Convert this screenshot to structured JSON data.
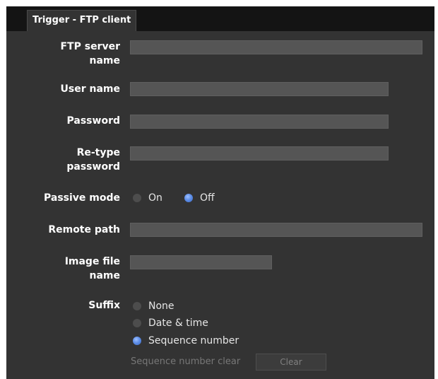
{
  "tab": {
    "title": "Trigger - FTP client"
  },
  "fields": {
    "ftp_server_name": {
      "label_line1": "FTP server",
      "label_line2": "name",
      "value": ""
    },
    "user_name": {
      "label": "User name",
      "value": ""
    },
    "password": {
      "label": "Password",
      "value": ""
    },
    "retype_password": {
      "label_line1": "Re-type",
      "label_line2": "password",
      "value": ""
    },
    "remote_path": {
      "label": "Remote path",
      "value": ""
    },
    "image_file_name": {
      "label_line1": "Image file",
      "label_line2": "name",
      "value": ""
    }
  },
  "passive_mode": {
    "label": "Passive mode",
    "options": [
      "On",
      "Off"
    ],
    "selected": "Off"
  },
  "suffix": {
    "label": "Suffix",
    "options": [
      "None",
      "Date & time",
      "Sequence number"
    ],
    "selected": "Sequence number"
  },
  "sequence_clear": {
    "label": "Sequence number clear",
    "button_label": "Clear"
  },
  "colors": {
    "panel_bg": "#333333",
    "header_bg": "#141414",
    "field_bg": "#555555",
    "radio_selected": "#5f8fe8"
  }
}
